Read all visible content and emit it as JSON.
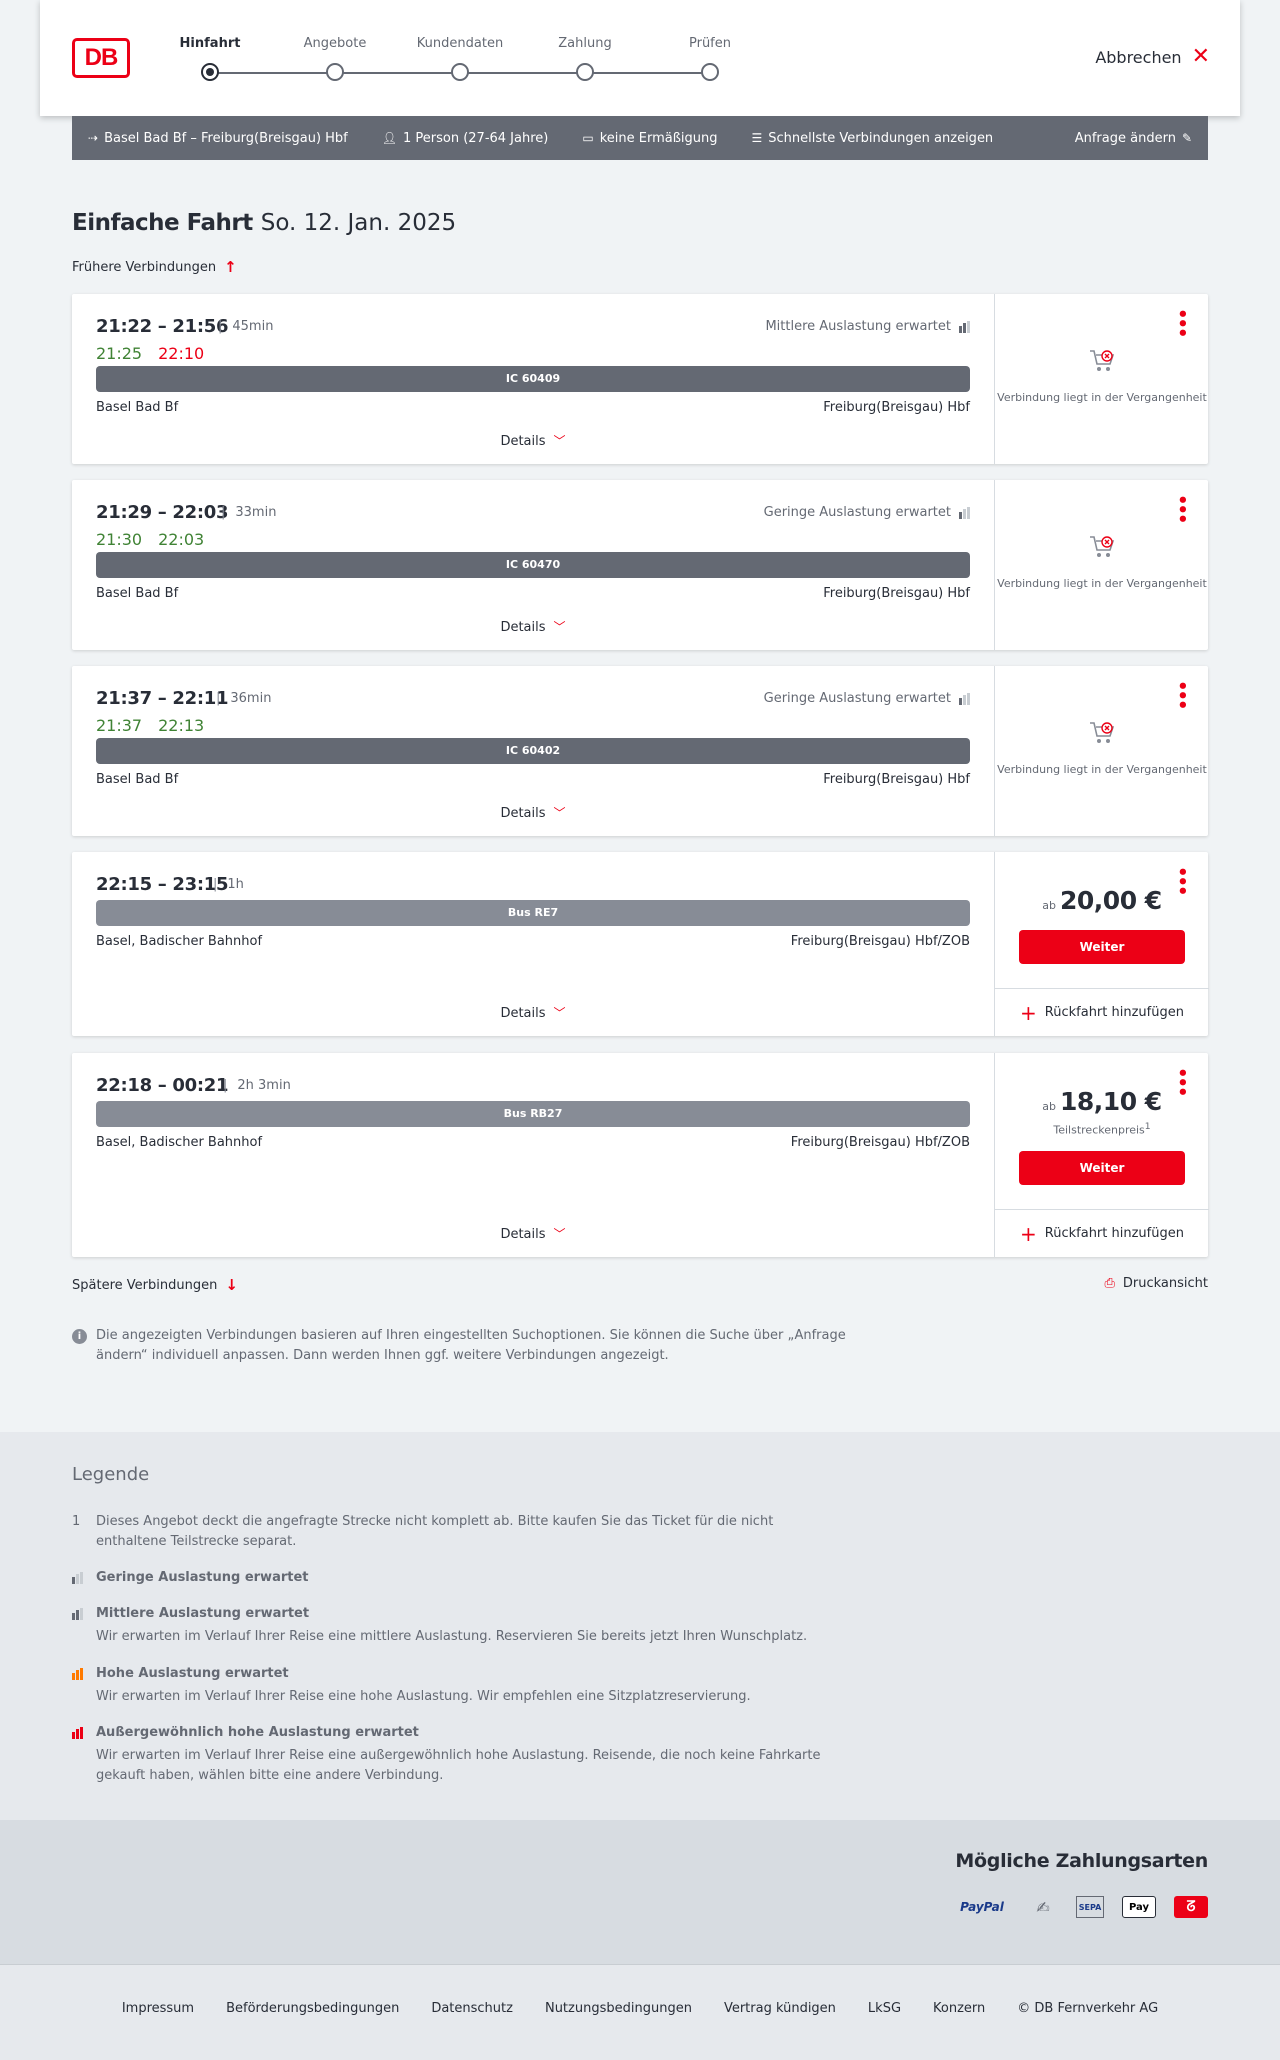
{
  "header": {
    "logo": "DB",
    "steps": [
      "Hinfahrt",
      "Angebote",
      "Kundendaten",
      "Zahlung",
      "Prüfen"
    ],
    "cancel_label": "Abbrechen"
  },
  "summary": {
    "route": "Basel Bad Bf – Freiburg(Breisgau) Hbf",
    "passengers": "1 Person (27-64 Jahre)",
    "discount": "keine Ermäßigung",
    "fastest": "Schnellste Verbindungen anzeigen",
    "edit": "Anfrage ändern"
  },
  "title": {
    "main": "Einfache Fahrt",
    "date": "So. 12. Jan. 2025"
  },
  "earlier_label": "Frühere Verbindungen",
  "later_label": "Spätere Verbindungen",
  "print_label": "Druckansicht",
  "connections": [
    {
      "times": "21:22 – 21:56",
      "duration": "45min",
      "rt_dep": "21:25",
      "rt_arr": "22:10",
      "occupancy": "Mittlere Auslastung erwartet",
      "train": "IC 60409",
      "from": "Basel Bad Bf",
      "to": "Freiburg(Breisgau) Hbf",
      "details": "Details",
      "status": "Verbindung liegt in der Vergangenheit"
    },
    {
      "times": "21:29 – 22:03",
      "duration": "33min",
      "rt_dep": "21:30",
      "rt_arr": "22:03",
      "occupancy": "Geringe Auslastung erwartet",
      "train": "IC 60470",
      "from": "Basel Bad Bf",
      "to": "Freiburg(Breisgau) Hbf",
      "details": "Details",
      "status": "Verbindung liegt in der Vergangenheit"
    },
    {
      "times": "21:37 – 22:11",
      "duration": "36min",
      "rt_dep": "21:37",
      "rt_arr": "22:13",
      "occupancy": "Geringe Auslastung erwartet",
      "train": "IC 60402",
      "from": "Basel Bad Bf",
      "to": "Freiburg(Breisgau) Hbf",
      "details": "Details",
      "status": "Verbindung liegt in der Vergangenheit"
    },
    {
      "times": "22:15 – 23:15",
      "duration": "1h",
      "train": "Bus RE7",
      "from": "Basel, Badischer Bahnhof",
      "to": "Freiburg(Breisgau) Hbf/ZOB",
      "details": "Details",
      "price_prefix": "ab",
      "price": "20,00 €",
      "button": "Weiter",
      "return": "Rückfahrt hinzufügen"
    },
    {
      "times": "22:18 – 00:21",
      "duration": "2h 3min",
      "train": "Bus RB27",
      "from": "Basel, Badischer Bahnhof",
      "to": "Freiburg(Breisgau) Hbf/ZOB",
      "details": "Details",
      "price_prefix": "ab",
      "price": "18,10 €",
      "partial": "Teilstreckenpreis",
      "partial_sup": "1",
      "button": "Weiter",
      "return": "Rückfahrt hinzufügen"
    }
  ],
  "info_text": "Die angezeigten Verbindungen basieren auf Ihren eingestellten Suchoptionen. Sie können die Suche über „Anfrage ändern“ individuell anpassen. Dann werden Ihnen ggf. weitere Verbindungen angezeigt.",
  "legend": {
    "title": "Legende",
    "note_number": "1",
    "note_text": "Dieses Angebot deckt die angefragte Strecke nicht komplett ab. Bitte kaufen Sie das Ticket für die nicht enthaltene Teilstrecke separat.",
    "items": [
      {
        "title": "Geringe Auslastung erwartet",
        "text": ""
      },
      {
        "title": "Mittlere Auslastung erwartet",
        "text": "Wir erwarten im Verlauf Ihrer Reise eine mittlere Auslastung. Reservieren Sie bereits jetzt Ihren Wunschplatz."
      },
      {
        "title": "Hohe Auslastung erwartet",
        "text": "Wir erwarten im Verlauf Ihrer Reise eine hohe Auslastung. Wir empfehlen eine Sitzplatzreservierung."
      },
      {
        "title": "Außergewöhnlich hohe Auslastung erwartet",
        "text": "Wir erwarten im Verlauf Ihrer Reise eine außergewöhnlich hohe Auslastung. Reisende, die noch keine Fahrkarte gekauft haben, wählen bitte eine andere Verbindung."
      }
    ]
  },
  "payment": {
    "title": "Mögliche Zahlungsarten",
    "methods": [
      "PayPal",
      "Lastschrift",
      "SEPA",
      "Pay",
      "DB"
    ]
  },
  "footer": {
    "links": [
      "Impressum",
      "Beförderungsbedingungen",
      "Datenschutz",
      "Nutzungsbedingungen",
      "Vertrag kündigen",
      "LkSG",
      "Konzern",
      "© DB Fernverkehr AG"
    ]
  },
  "colors": {
    "accent": "#ec0016",
    "bar": "#646973",
    "green": "#408335",
    "bg": "#f0f3f5"
  }
}
